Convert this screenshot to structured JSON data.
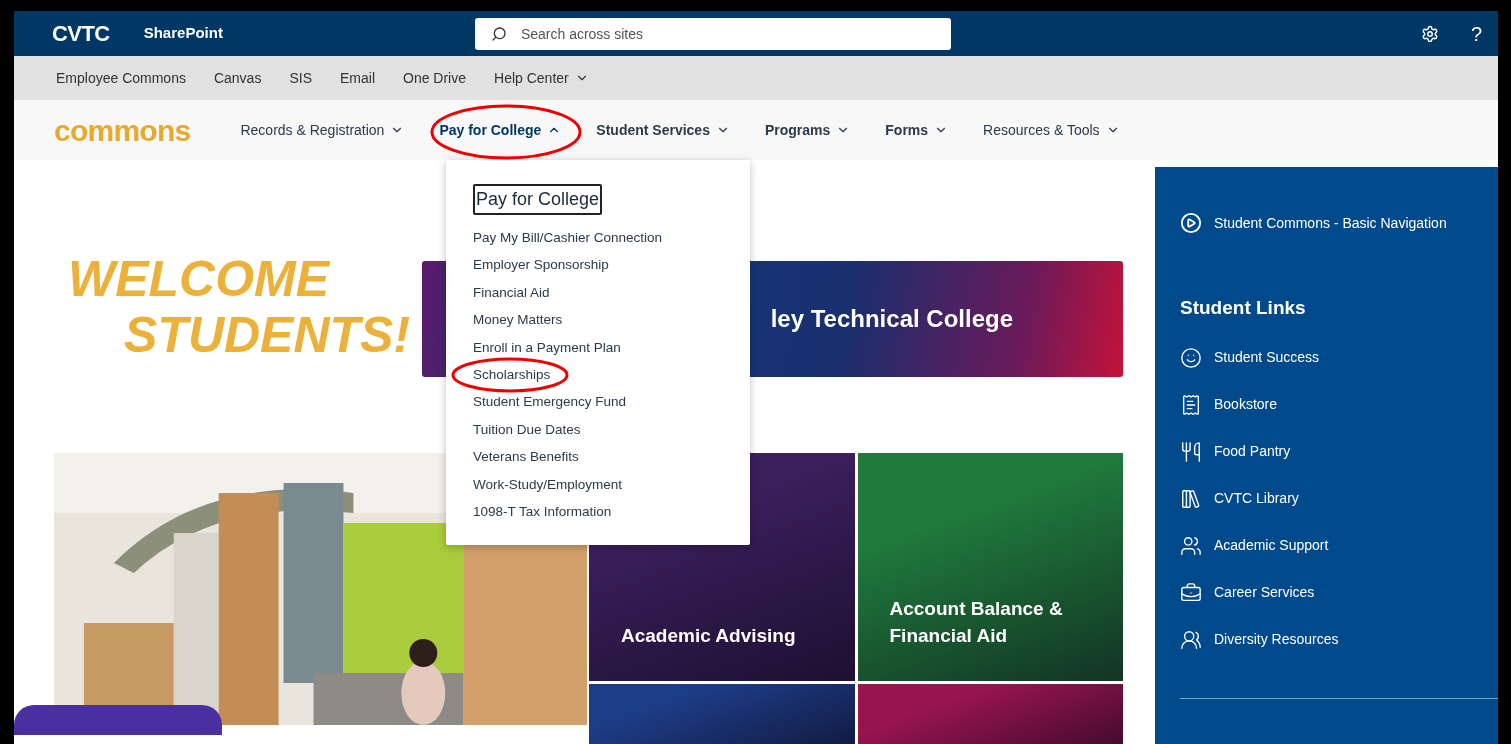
{
  "suite_bar": {
    "logo": "CVTC",
    "app": "SharePoint",
    "search": {
      "placeholder": "Search across sites"
    },
    "help": "?"
  },
  "hub_nav": [
    {
      "label": "Employee Commons",
      "dropdown": false
    },
    {
      "label": "Canvas",
      "dropdown": false
    },
    {
      "label": "SIS",
      "dropdown": false
    },
    {
      "label": "Email",
      "dropdown": false
    },
    {
      "label": "One Drive",
      "dropdown": false
    },
    {
      "label": "Help Center",
      "dropdown": true
    }
  ],
  "site": {
    "logo": "commons"
  },
  "site_nav": [
    {
      "label": "Records & Registration",
      "expanded": false
    },
    {
      "label": "Pay for College",
      "expanded": true
    },
    {
      "label": "Student Services",
      "expanded": false
    },
    {
      "label": "Programs",
      "expanded": false
    },
    {
      "label": "Forms",
      "expanded": false
    },
    {
      "label": "Resources & Tools",
      "expanded": false
    }
  ],
  "dropdown": {
    "heading": "Pay for College",
    "items": [
      {
        "label": "Pay My Bill/Cashier Connection",
        "highlighted": false
      },
      {
        "label": "Employer Sponsorship",
        "highlighted": false
      },
      {
        "label": "Financial Aid",
        "highlighted": false
      },
      {
        "label": "Money Matters",
        "highlighted": false
      },
      {
        "label": "Enroll in a Payment Plan",
        "highlighted": false
      },
      {
        "label": "Scholarships",
        "highlighted": true
      },
      {
        "label": "Student Emergency Fund",
        "highlighted": false
      },
      {
        "label": "Tuition Due Dates",
        "highlighted": false
      },
      {
        "label": "Veterans Benefits",
        "highlighted": false
      },
      {
        "label": "Work-Study/Employment",
        "highlighted": false
      },
      {
        "label": "1098-T Tax Information",
        "highlighted": false
      }
    ]
  },
  "welcome": {
    "line_1": "WELCOME",
    "line_2": "STUDENTS!"
  },
  "banner": {
    "title": "ley Technical College"
  },
  "tiles": [
    {
      "kind": "picture"
    },
    {
      "kind": "tile",
      "title": "Academic Advising",
      "color": "#3a1f5c"
    },
    {
      "kind": "tile",
      "title": "Account Balance & Financial Aid",
      "color": "#1f7a3c"
    },
    {
      "kind": "tile",
      "color": "#1d3c86"
    },
    {
      "kind": "tile",
      "color": "#9a1550"
    }
  ],
  "side_panel": {
    "video_link": "Student Commons - Basic Navigation",
    "heading": "Student Links",
    "links": [
      {
        "label": "Student Success"
      },
      {
        "label": "Bookstore"
      },
      {
        "label": "Food Pantry"
      },
      {
        "label": "CVTC Library"
      },
      {
        "label": "Academic Support"
      },
      {
        "label": "Career Services"
      },
      {
        "label": "Diversity Resources"
      }
    ]
  }
}
